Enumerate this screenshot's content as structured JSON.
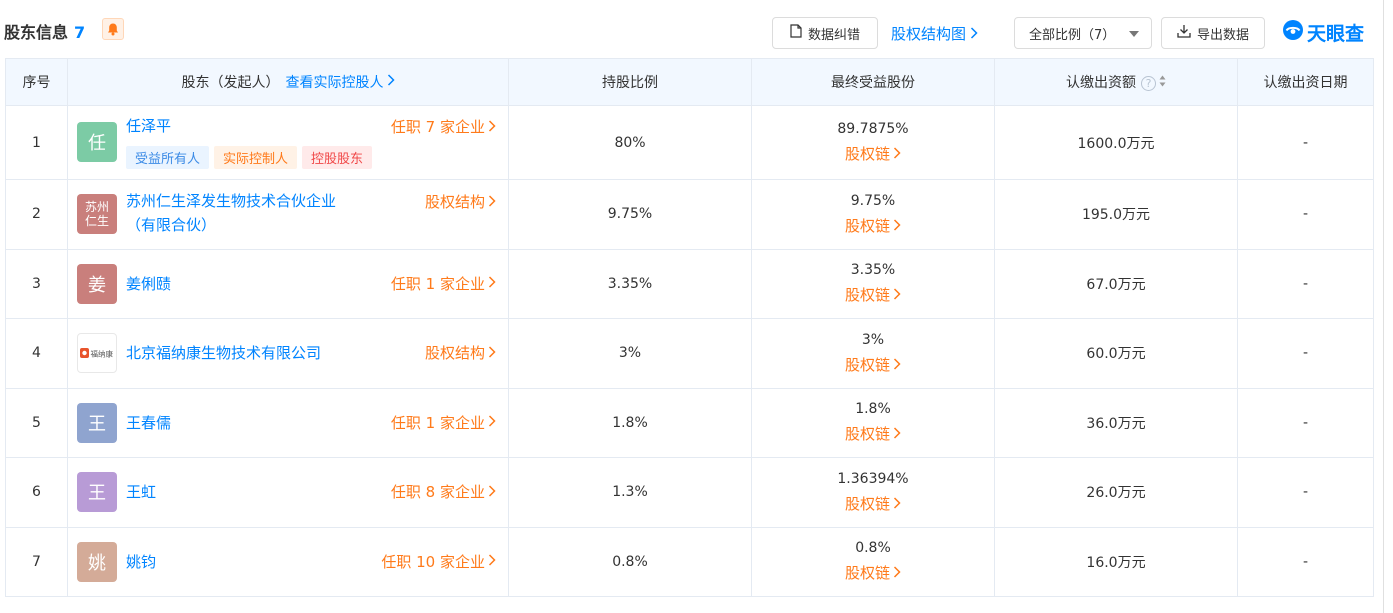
{
  "header": {
    "title": "股东信息",
    "count": "7",
    "correct_btn": "数据纠错",
    "structure_link": "股权结构图",
    "ratio_filter": "全部比例（7）",
    "export_btn": "导出数据",
    "logo_text": "天眼查"
  },
  "columns": {
    "index": "序号",
    "shareholder": "股东（发起人）",
    "shareholder_link": "查看实际控股人",
    "ratio": "持股比例",
    "final": "最终受益股份",
    "subscribed": "认缴出资额",
    "date": "认缴出资日期"
  },
  "rows": [
    {
      "index": "1",
      "avatar": "任",
      "avatar_color": "#7ccba5",
      "name": "任泽平",
      "link": "任职 7 家企业",
      "ratio": "80%",
      "final": "89.7875%",
      "chain": "股权链",
      "amount": "1600.0万元",
      "date": "-",
      "tags": [
        "受益所有人",
        "实际控制人",
        "控股股东"
      ]
    },
    {
      "index": "2",
      "avatar_line1": "苏州",
      "avatar_line2": "仁生",
      "avatar_color": "#c97f7c",
      "name_line1": "苏州仁生泽发生物技术合伙企业",
      "name_line2": "（有限合伙）",
      "link": "股权结构",
      "ratio": "9.75%",
      "final": "9.75%",
      "chain": "股权链",
      "amount": "195.0万元",
      "date": "-"
    },
    {
      "index": "3",
      "avatar": "姜",
      "avatar_color": "#c97f7c",
      "name": "姜俐赜",
      "link": "任职 1 家企业",
      "ratio": "3.35%",
      "final": "3.35%",
      "chain": "股权链",
      "amount": "67.0万元",
      "date": "-"
    },
    {
      "index": "4",
      "avatar_logo": "福纳康",
      "name": "北京福纳康生物技术有限公司",
      "link": "股权结构",
      "ratio": "3%",
      "final": "3%",
      "chain": "股权链",
      "amount": "60.0万元",
      "date": "-"
    },
    {
      "index": "5",
      "avatar": "王",
      "avatar_color": "#8fa4cf",
      "name": "王春儒",
      "link": "任职 1 家企业",
      "ratio": "1.8%",
      "final": "1.8%",
      "chain": "股权链",
      "amount": "36.0万元",
      "date": "-"
    },
    {
      "index": "6",
      "avatar": "王",
      "avatar_color": "#b89bd6",
      "name": "王虹",
      "link": "任职 8 家企业",
      "ratio": "1.3%",
      "final": "1.36394%",
      "chain": "股权链",
      "amount": "26.0万元",
      "date": "-"
    },
    {
      "index": "7",
      "avatar": "姚",
      "avatar_color": "#d4ab98",
      "name": "姚钧",
      "link": "任职 10 家企业",
      "ratio": "0.8%",
      "final": "0.8%",
      "chain": "股权链",
      "amount": "16.0万元",
      "date": "-"
    }
  ],
  "colors": {
    "accent_blue": "#0084ff",
    "accent_orange": "#ff7a1a",
    "header_bg": "#f2f8ff"
  }
}
